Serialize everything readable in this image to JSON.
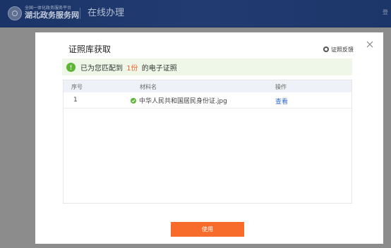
{
  "header": {
    "logo_small_text": "全国一体化政务服务平台",
    "logo_main_text": "湖北政务服务网",
    "section_title": "在线办理",
    "right_text": "登",
    "background_color": "#1d3669"
  },
  "modal": {
    "title": "证照库获取",
    "feedback_label": "证照反馈",
    "close_icon": "close-icon",
    "notice": {
      "prefix": "已为您匹配到",
      "count": "1份",
      "suffix": "的电子证照",
      "icon": "check-circle-icon",
      "accent_color": "#f5622f"
    },
    "table": {
      "columns": [
        "序号",
        "材料名",
        "操作"
      ],
      "rows": [
        {
          "index": "1",
          "file_name": "中华人民共和国居民身份证.jpg",
          "action": "查看"
        }
      ]
    },
    "use_button_label": "使用",
    "use_button_color": "#f76b2b",
    "success_color": "#5cb533",
    "link_color": "#2f6bd0"
  }
}
